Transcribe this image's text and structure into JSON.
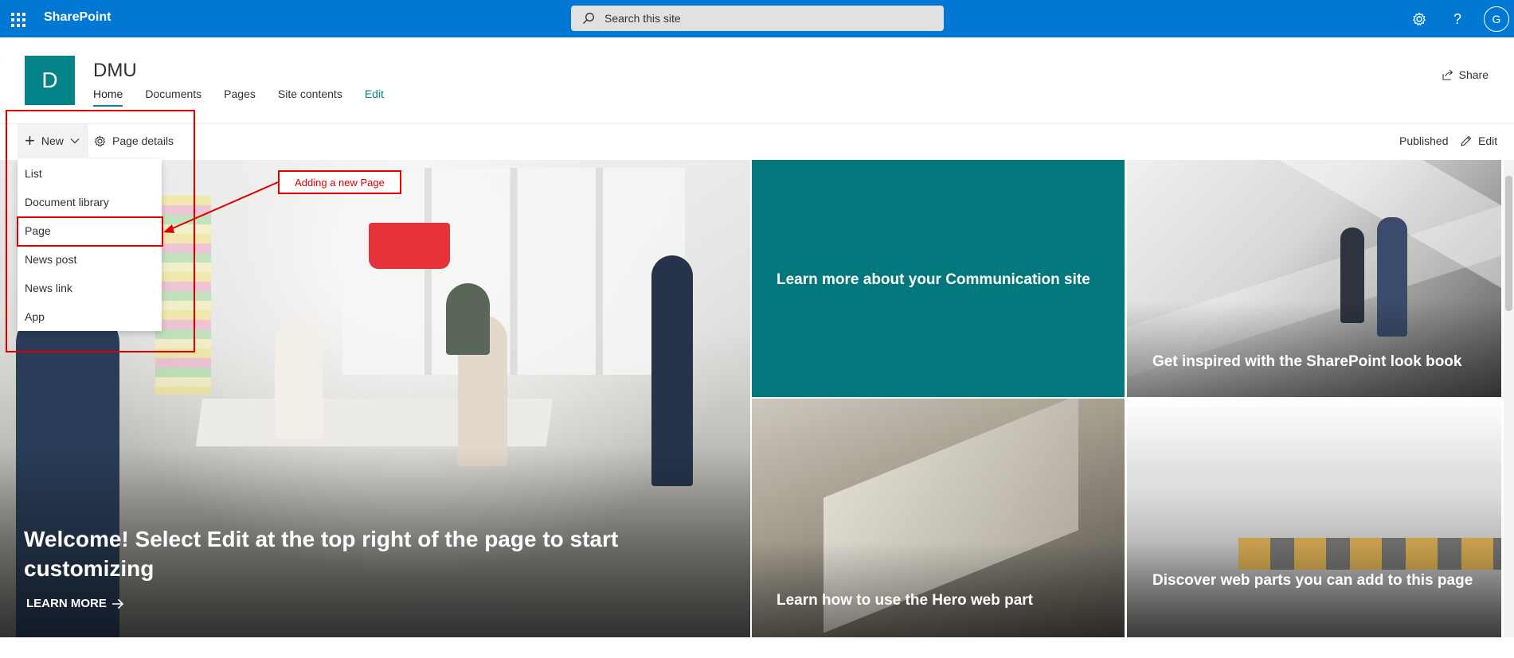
{
  "suitebar": {
    "brand": "SharePoint",
    "search_placeholder": "Search this site",
    "avatar_initial": "G",
    "help_label": "?"
  },
  "site": {
    "logo_letter": "D",
    "title": "DMU",
    "nav": [
      {
        "label": "Home",
        "active": true
      },
      {
        "label": "Documents"
      },
      {
        "label": "Pages"
      },
      {
        "label": "Site contents"
      },
      {
        "label": "Edit"
      }
    ],
    "share_label": "Share"
  },
  "commandbar": {
    "new_label": "New",
    "page_details_label": "Page details",
    "status": "Published",
    "edit_label": "Edit"
  },
  "new_menu": {
    "items": [
      "List",
      "Document library",
      "Page",
      "News post",
      "News link",
      "App"
    ]
  },
  "annotation": {
    "label": "Adding a new Page",
    "color": "#e00000"
  },
  "hero": {
    "main_title": "Welcome! Select Edit at the top right of the page to start customizing",
    "learn_more": "LEARN MORE",
    "tiles": [
      "Learn more about your Communication site",
      "Get inspired with the SharePoint look book",
      "Learn how to use the Hero web part",
      "Discover web parts you can add to this page"
    ]
  },
  "colors": {
    "suitebar": "#0078d4",
    "site_logo": "#038387",
    "teal_tile": "#03787c"
  }
}
